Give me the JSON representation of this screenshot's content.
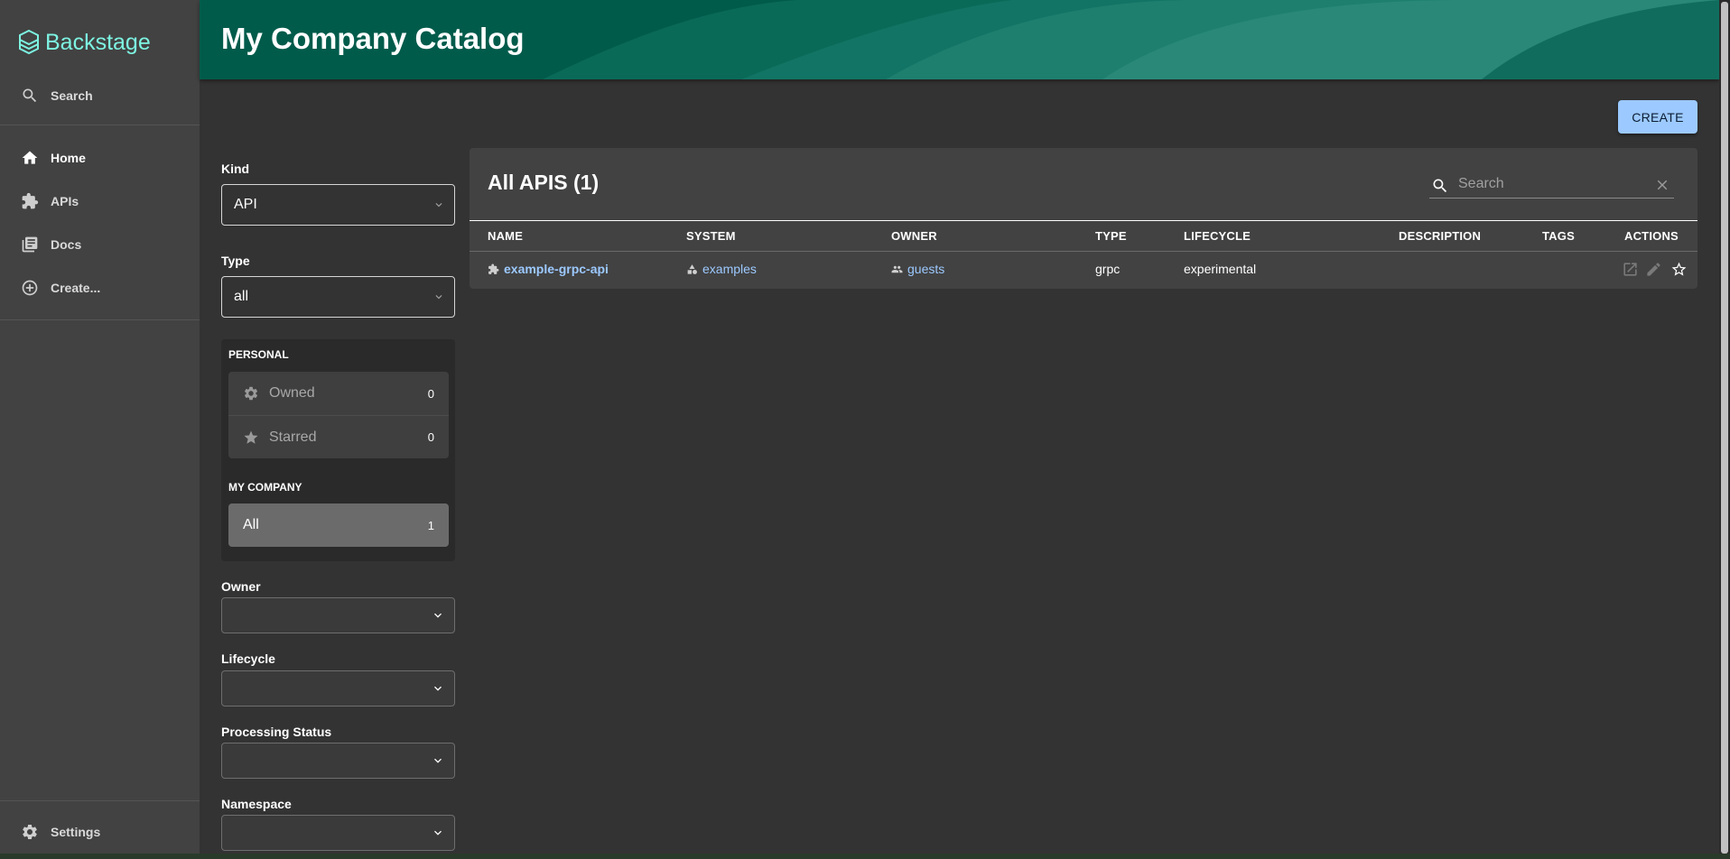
{
  "sidebar": {
    "logo_text": "Backstage",
    "items": [
      {
        "label": "Search",
        "icon": "search-icon"
      },
      {
        "label": "Home",
        "icon": "home-icon",
        "active": true
      },
      {
        "label": "APIs",
        "icon": "puzzle-icon"
      },
      {
        "label": "Docs",
        "icon": "library-books-icon"
      },
      {
        "label": "Create...",
        "icon": "add-circle-outline-icon"
      }
    ],
    "settings_label": "Settings"
  },
  "header": {
    "title": "My Company Catalog"
  },
  "create_button": "CREATE",
  "filters": {
    "kind_label": "Kind",
    "kind_value": "API",
    "type_label": "Type",
    "type_value": "all",
    "personal_title": "PERSONAL",
    "owned_label": "Owned",
    "owned_count": "0",
    "starred_label": "Starred",
    "starred_count": "0",
    "company_title": "MY COMPANY",
    "all_label": "All",
    "all_count": "1",
    "owner_label": "Owner",
    "lifecycle_label": "Lifecycle",
    "processing_status_label": "Processing Status",
    "namespace_label": "Namespace"
  },
  "table": {
    "title": "All APIS (1)",
    "search_placeholder": "Search",
    "columns": [
      "NAME",
      "SYSTEM",
      "OWNER",
      "TYPE",
      "LIFECYCLE",
      "DESCRIPTION",
      "TAGS",
      "ACTIONS"
    ],
    "rows": [
      {
        "name": "example-grpc-api",
        "system": "examples",
        "owner": "guests",
        "type": "grpc",
        "lifecycle": "experimental",
        "description": "",
        "tags": ""
      }
    ]
  },
  "colors": {
    "accent": "#9cc9ff",
    "header_bg": "#005b4b",
    "logo": "#7df3e1",
    "sidebar_bg": "#424242",
    "page_bg": "#333333"
  }
}
